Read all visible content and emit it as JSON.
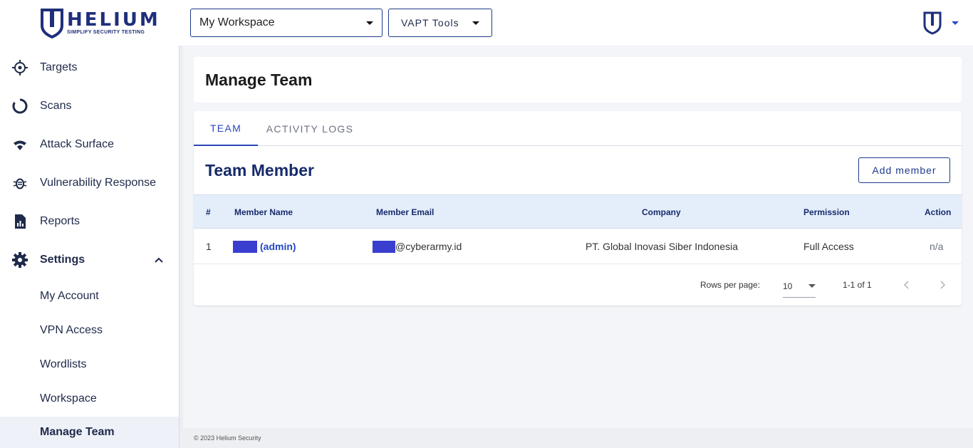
{
  "brand": {
    "name": "HELIUM",
    "tagline": "SIMPLIFY SECURITY TESTING"
  },
  "header": {
    "workspace_select": {
      "value": "My Workspace"
    },
    "tools_button": "VAPT Tools",
    "user_menu_icon": "helium-shield-icon"
  },
  "sidebar": {
    "items": [
      {
        "label": "Targets",
        "icon": "target-icon"
      },
      {
        "label": "Scans",
        "icon": "scan-ring-icon"
      },
      {
        "label": "Attack Surface",
        "icon": "wifi-icon"
      },
      {
        "label": "Vulnerability Response",
        "icon": "bug-icon"
      },
      {
        "label": "Reports",
        "icon": "report-icon"
      },
      {
        "label": "Settings",
        "icon": "gear-icon",
        "expanded": true
      }
    ],
    "settings_children": [
      {
        "label": "My Account"
      },
      {
        "label": "VPN Access"
      },
      {
        "label": "Wordlists"
      },
      {
        "label": "Workspace"
      },
      {
        "label": "Manage Team",
        "active": true
      }
    ]
  },
  "page": {
    "title": "Manage Team"
  },
  "tabs": [
    {
      "label": "TEAM",
      "active": true
    },
    {
      "label": "ACTIVITY LOGS",
      "active": false
    }
  ],
  "team": {
    "section_title": "Team Member",
    "add_button": "Add member",
    "columns": [
      "#",
      "Member Name",
      "Member Email",
      "Company",
      "Permission",
      "Action"
    ],
    "rows": [
      {
        "index": "1",
        "name_suffix": "(admin)",
        "email_suffix": "@cyberarmy.id",
        "company": "PT. Global Inovasi Siber Indonesia",
        "permission": "Full Access",
        "action": "n/a"
      }
    ],
    "pagination": {
      "rows_per_page_label": "Rows per page:",
      "rows_per_page": "10",
      "range": "1-1 of 1"
    }
  },
  "footer": {
    "text": "© 2023 Helium Security"
  },
  "colors": {
    "brand_navy": "#1f2f7a",
    "accent_blue": "#2b46b8",
    "header_row": "#e4eefb",
    "redaction": "#3a3ecf"
  }
}
